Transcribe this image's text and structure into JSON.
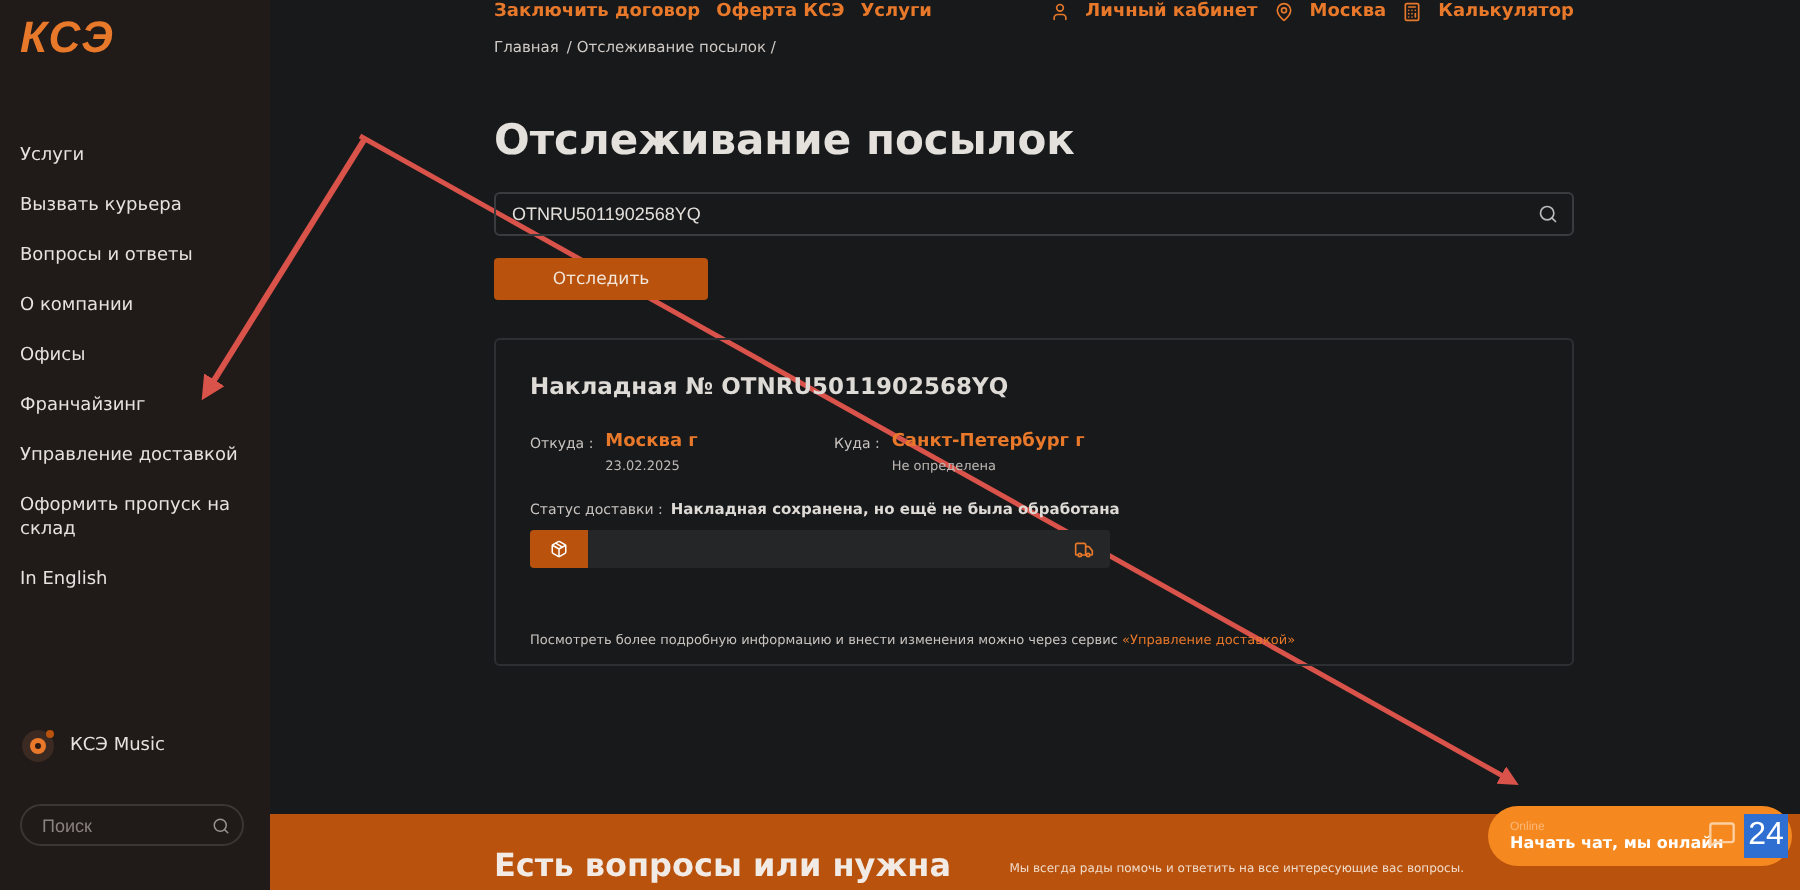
{
  "logo": "КСЭ",
  "sidebar": {
    "items": [
      {
        "label": "Услуги"
      },
      {
        "label": "Вызвать курьера"
      },
      {
        "label": "Вопросы и ответы"
      },
      {
        "label": "О компании"
      },
      {
        "label": "Офисы"
      },
      {
        "label": "Франчайзинг"
      },
      {
        "label": "Управление доставкой"
      },
      {
        "label": "Оформить пропуск на склад"
      },
      {
        "label": "In English"
      }
    ],
    "music": "КСЭ Music",
    "search": {
      "placeholder": "Поиск"
    }
  },
  "top_nav": {
    "links": [
      "Заключить договор",
      "Оферта КСЭ",
      "Услуги"
    ],
    "account": "Личный кабинет",
    "city": "Москва",
    "calculator": "Калькулятор"
  },
  "breadcrumbs": [
    "Главная",
    "/ Отслеживание посылок /"
  ],
  "title": "Отслеживание посылок",
  "tracking_field": {
    "value": "OTNRU5011902568YQ"
  },
  "track_button": "Отследить",
  "waybill": {
    "title": "Накладная № OTNRU5011902568YQ",
    "from_label": "Откуда :",
    "from_city": "Москва г",
    "from_date": "23.02.2025",
    "to_label": "Куда :",
    "to_city": "Санкт-Петербург г",
    "to_date": "Не определена",
    "status_label": "Статус доставки :",
    "status": "Накладная сохранена, но ещё не была обработана",
    "progress": {
      "level": 0.1
    },
    "note": "Посмотреть более подробную информацию и внести изменения можно через сервис ",
    "note_link": "«Управление доставкой»"
  },
  "footer": {
    "heading": "Есть вопросы или нужна",
    "text": "Мы всегда рады помочь и ответить на все интересующие вас вопросы."
  },
  "chat": {
    "status": "Online",
    "label": "Начать чат, мы онлайн",
    "badge": "24"
  }
}
